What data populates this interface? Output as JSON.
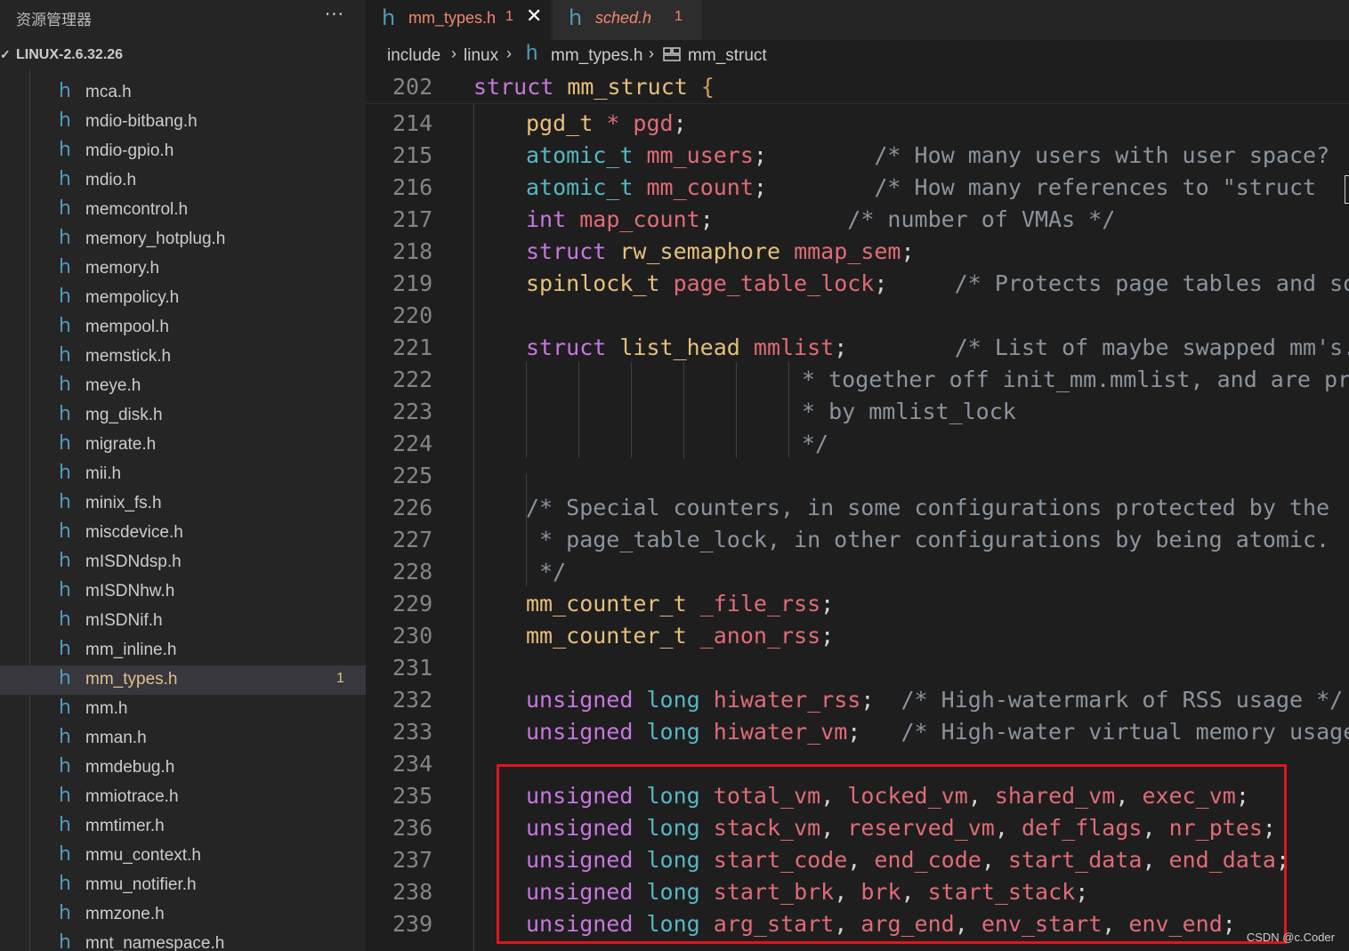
{
  "sidebar": {
    "title": "资源管理器",
    "more": "···",
    "root_label": "LINUX-2.6.32.26",
    "root_chevron": "✓",
    "file_icon_glyph": "h",
    "files": [
      {
        "name": "mca.h",
        "badge": ""
      },
      {
        "name": "mdio-bitbang.h",
        "badge": ""
      },
      {
        "name": "mdio-gpio.h",
        "badge": ""
      },
      {
        "name": "mdio.h",
        "badge": ""
      },
      {
        "name": "memcontrol.h",
        "badge": ""
      },
      {
        "name": "memory_hotplug.h",
        "badge": ""
      },
      {
        "name": "memory.h",
        "badge": ""
      },
      {
        "name": "mempolicy.h",
        "badge": ""
      },
      {
        "name": "mempool.h",
        "badge": ""
      },
      {
        "name": "memstick.h",
        "badge": ""
      },
      {
        "name": "meye.h",
        "badge": ""
      },
      {
        "name": "mg_disk.h",
        "badge": ""
      },
      {
        "name": "migrate.h",
        "badge": ""
      },
      {
        "name": "mii.h",
        "badge": ""
      },
      {
        "name": "minix_fs.h",
        "badge": ""
      },
      {
        "name": "miscdevice.h",
        "badge": ""
      },
      {
        "name": "mISDNdsp.h",
        "badge": ""
      },
      {
        "name": "mISDNhw.h",
        "badge": ""
      },
      {
        "name": "mISDNif.h",
        "badge": ""
      },
      {
        "name": "mm_inline.h",
        "badge": ""
      },
      {
        "name": "mm_types.h",
        "badge": "1",
        "selected": true
      },
      {
        "name": "mm.h",
        "badge": ""
      },
      {
        "name": "mman.h",
        "badge": ""
      },
      {
        "name": "mmdebug.h",
        "badge": ""
      },
      {
        "name": "mmiotrace.h",
        "badge": ""
      },
      {
        "name": "mmtimer.h",
        "badge": ""
      },
      {
        "name": "mmu_context.h",
        "badge": ""
      },
      {
        "name": "mmu_notifier.h",
        "badge": ""
      },
      {
        "name": "mmzone.h",
        "badge": ""
      },
      {
        "name": "mnt_namespace.h",
        "badge": ""
      }
    ]
  },
  "tabs": {
    "icon_glyph": "h",
    "active": {
      "label": "mm_types.h",
      "badge": "1",
      "close": "✕"
    },
    "inactive": {
      "label": "sched.h",
      "badge": "1"
    }
  },
  "breadcrumb": {
    "items": [
      "include",
      "linux",
      "mm_types.h",
      "mm_struct"
    ],
    "sep": "›"
  },
  "editor": {
    "sticky": {
      "ln": "202",
      "code": "struct mm_struct {"
    },
    "lines": [
      {
        "ln": "214"
      },
      {
        "ln": "215"
      },
      {
        "ln": "216"
      },
      {
        "ln": "217"
      },
      {
        "ln": "218"
      },
      {
        "ln": "219"
      },
      {
        "ln": "220"
      },
      {
        "ln": "221"
      },
      {
        "ln": "222"
      },
      {
        "ln": "223"
      },
      {
        "ln": "224"
      },
      {
        "ln": "225"
      },
      {
        "ln": "226"
      },
      {
        "ln": "227"
      },
      {
        "ln": "228"
      },
      {
        "ln": "229"
      },
      {
        "ln": "230"
      },
      {
        "ln": "231"
      },
      {
        "ln": "232"
      },
      {
        "ln": "233"
      },
      {
        "ln": "234"
      },
      {
        "ln": "235"
      },
      {
        "ln": "236"
      },
      {
        "ln": "237"
      },
      {
        "ln": "238"
      },
      {
        "ln": "239"
      }
    ],
    "code": {
      "l214": [
        "pgd_t",
        " * ",
        "pgd",
        ";"
      ],
      "l215": [
        "atomic_t",
        " ",
        "mm_users",
        ";",
        "        /* How many users with user space?"
      ],
      "l216": [
        "atomic_t",
        " ",
        "mm_count",
        ";",
        "        /* How many references to \"struct "
      ],
      "l217": [
        "int",
        " ",
        "map_count",
        ";",
        "          /* number of VMAs */"
      ],
      "l218": [
        "struct",
        " ",
        "rw_semaphore",
        " ",
        "mmap_sem",
        ";"
      ],
      "l219": [
        "spinlock_t",
        " ",
        "page_table_lock",
        ";",
        "     /* Protects page tables and som"
      ],
      "l221": [
        "struct",
        " ",
        "list_head",
        " ",
        "mmlist",
        ";",
        "        /* List of maybe swapped mm's."
      ],
      "l222": "* together off init_mm.mmlist, and are pro",
      "l223": "* by mmlist_lock",
      "l224": "*/",
      "l226": "/* Special counters, in some configurations protected by the",
      "l227": " * page_table_lock, in other configurations by being atomic.",
      "l228": " */",
      "l229": [
        "mm_counter_t",
        " ",
        "_file_rss",
        ";"
      ],
      "l230": [
        "mm_counter_t",
        " ",
        "_anon_rss",
        ";"
      ],
      "l232": [
        "unsigned",
        " ",
        "long",
        " ",
        "hiwater_rss",
        ";",
        "  /* High-watermark of RSS usage */"
      ],
      "l233": [
        "unsigned",
        " ",
        "long",
        " ",
        "hiwater_vm",
        ";",
        "   /* High-water virtual memory usage"
      ],
      "l235": [
        "unsigned",
        " ",
        "long",
        " ",
        "total_vm",
        ", ",
        "locked_vm",
        ", ",
        "shared_vm",
        ", ",
        "exec_vm",
        ";"
      ],
      "l236": [
        "unsigned",
        " ",
        "long",
        " ",
        "stack_vm",
        ", ",
        "reserved_vm",
        ", ",
        "def_flags",
        ", ",
        "nr_ptes",
        ";"
      ],
      "l237": [
        "unsigned",
        " ",
        "long",
        " ",
        "start_code",
        ", ",
        "end_code",
        ", ",
        "start_data",
        ", ",
        "end_data",
        ";"
      ],
      "l238": [
        "unsigned",
        " ",
        "long",
        " ",
        "start_brk",
        ", ",
        "brk",
        ", ",
        "start_stack",
        ";"
      ],
      "l239": [
        "unsigned",
        " ",
        "long",
        " ",
        "arg_start",
        ", ",
        "arg_end",
        ", ",
        "env_start",
        ", ",
        "env_end",
        ";"
      ]
    }
  },
  "watermark": "CSDN @c.Coder",
  "colors": {
    "keyword": "#c678dd",
    "type": "#56b6c2",
    "struct_type": "#e5c07b",
    "variable": "#e06c75",
    "comment": "#8b949e",
    "highlight_box": "#e0141e",
    "icon_h": "#519aba"
  }
}
